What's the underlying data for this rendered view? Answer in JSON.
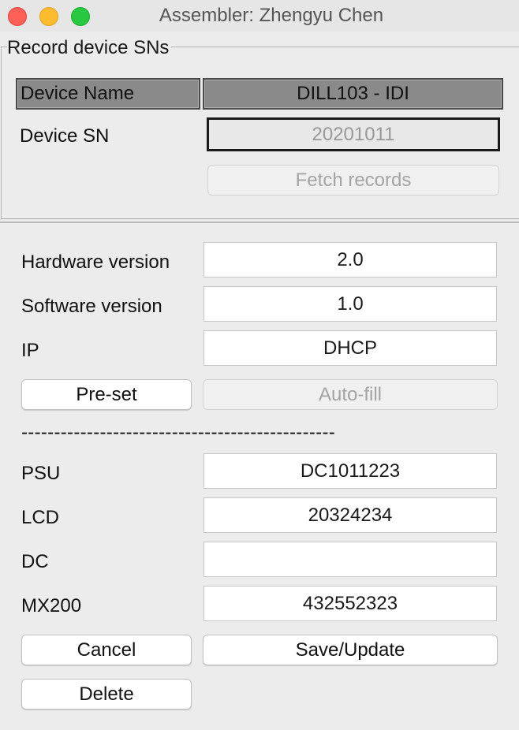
{
  "window": {
    "title": "Assembler: Zhengyu Chen"
  },
  "record_group": {
    "legend": "Record device SNs",
    "header_label": "Device Name",
    "header_value": "DILL103 - IDI",
    "sn_label": "Device SN",
    "sn_value": "20201011",
    "fetch_label": "Fetch records"
  },
  "versions": {
    "hardware_label": "Hardware version",
    "hardware_value": "2.0",
    "software_label": "Software version",
    "software_value": "1.0",
    "ip_label": "IP",
    "ip_value": "DHCP",
    "preset_label": "Pre-set",
    "autofill_label": "Auto-fill"
  },
  "separator": "------------------------------------------------",
  "components": {
    "psu_label": "PSU",
    "psu_value": "DC1011223",
    "lcd_label": "LCD",
    "lcd_value": "20324234",
    "dc_label": "DC",
    "dc_value": "",
    "mx200_label": "MX200",
    "mx200_value": "432552323"
  },
  "actions": {
    "cancel_label": "Cancel",
    "save_label": "Save/Update",
    "delete_label": "Delete"
  },
  "colors": {
    "close": "#fe5f57",
    "minimize": "#febc2e",
    "zoom": "#28c840",
    "header_bg": "#8a8a8a",
    "window_bg": "#ececec"
  }
}
